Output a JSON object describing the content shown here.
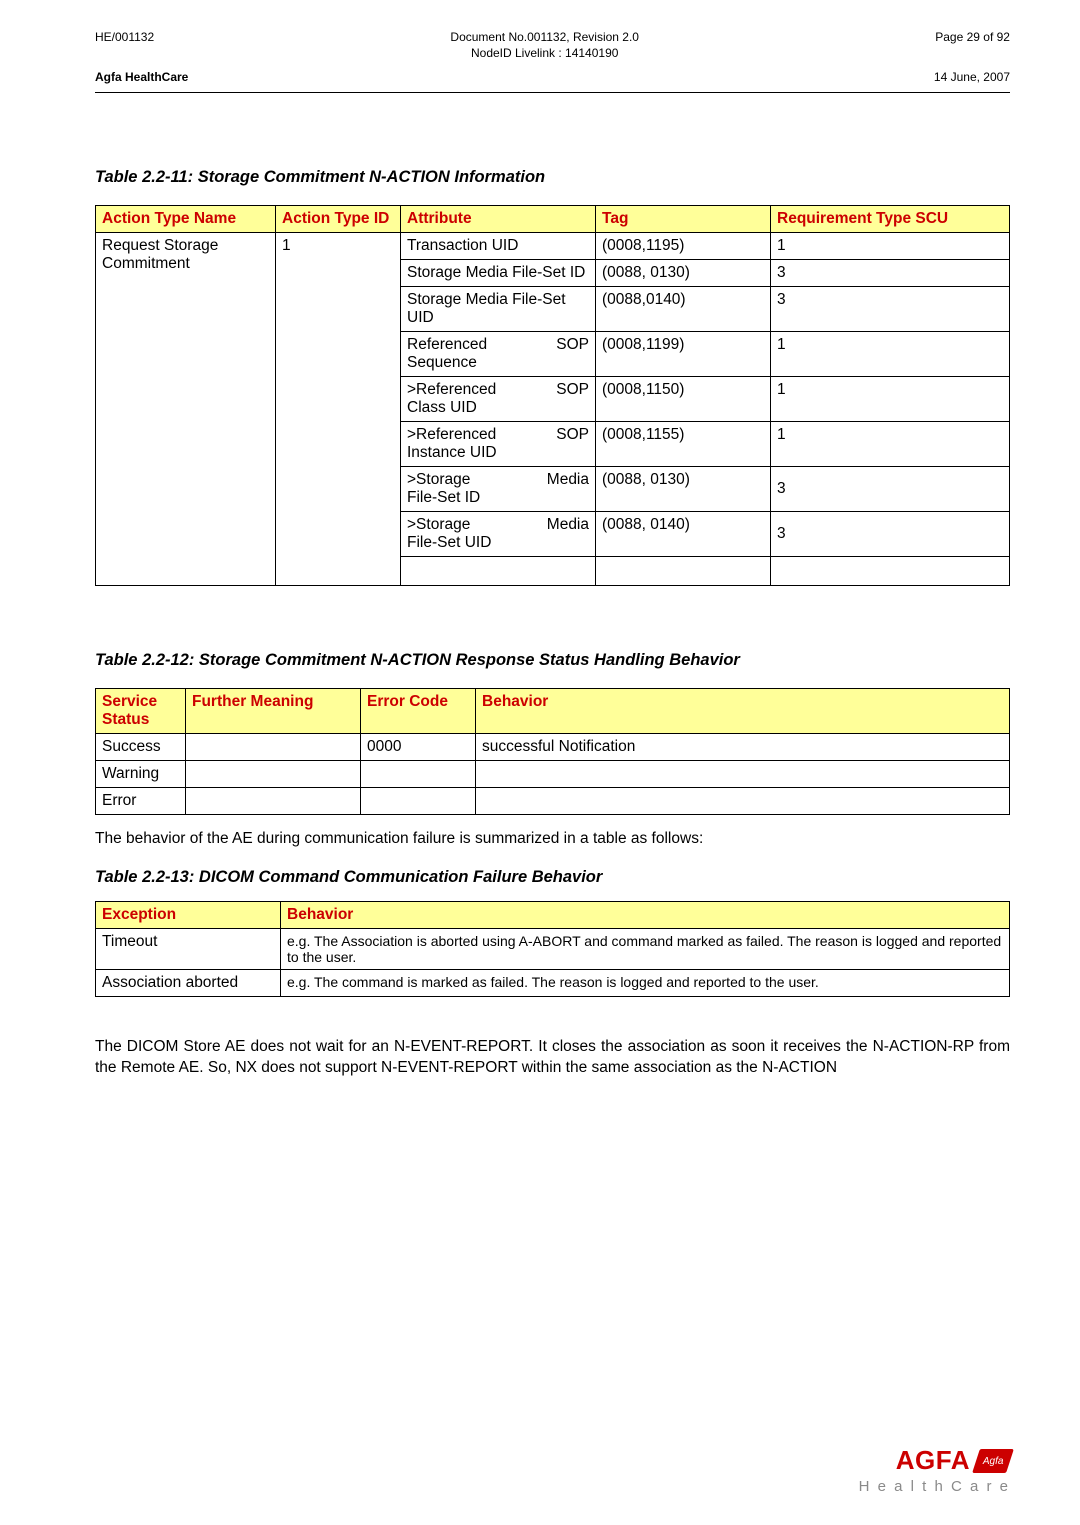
{
  "header": {
    "left_top": "HE/001132",
    "right_top": "Page 29 of 92",
    "center_line1": "Document No.001132, Revision 2.0",
    "center_line2": "NodeID Livelink : 14140190",
    "left_bottom": "Agfa HealthCare",
    "right_bottom": "14 June, 2007"
  },
  "t1": {
    "caption": "Table 2.2-11: Storage Commitment N-ACTION Information",
    "headers": {
      "h1": "Action Type Name",
      "h2": "Action Type ID",
      "h3": "Attribute",
      "h4": "Tag",
      "h5": "Requirement Type SCU"
    },
    "name": "Request Storage Commitment",
    "typeid": "1",
    "rows": [
      {
        "attr": "Transaction UID",
        "attr_r": "",
        "tag": "(0008,1195)",
        "req": "1"
      },
      {
        "attr": "Storage Media File-Set ID",
        "attr_r": "",
        "tag": "(0088, 0130)",
        "req": "3"
      },
      {
        "attr": "Storage Media File-Set UID",
        "attr_r": "",
        "tag": "(0088,0140)",
        "req": "3"
      },
      {
        "attr": "Referenced",
        "attr_r": "SOP",
        "attr2": "Sequence",
        "tag": "(0008,1199)",
        "req": "1"
      },
      {
        "attr": ">Referenced",
        "attr_r": "SOP",
        "attr2": "Class UID",
        "tag": "(0008,1150)",
        "req": "1"
      },
      {
        "attr": ">Referenced",
        "attr_r": "SOP",
        "attr2": "Instance UID",
        "tag": "(0008,1155)",
        "req": "1"
      },
      {
        "attr": ">Storage",
        "attr_r": "Media",
        "attr2": "File-Set ID",
        "tag": "(0088, 0130)",
        "req": "3"
      },
      {
        "attr": ">Storage",
        "attr_r": "Media",
        "attr2": "File-Set UID",
        "tag": "(0088, 0140)",
        "req": "3"
      }
    ]
  },
  "t2": {
    "caption": "Table 2.2-12: Storage Commitment N-ACTION Response Status Handling Behavior",
    "headers": {
      "h1": "Service Status",
      "h2": "Further Meaning",
      "h3": "Error Code",
      "h4": "Behavior"
    },
    "rows": [
      {
        "status": "Success",
        "fm": "",
        "code": "0000",
        "behavior": "successful Notification"
      },
      {
        "status": "Warning",
        "fm": "",
        "code": "",
        "behavior": ""
      },
      {
        "status": "Error",
        "fm": "",
        "code": "",
        "behavior": ""
      }
    ]
  },
  "para1": "The behavior of the AE during communication failure is summarized in a table as follows:",
  "t3": {
    "caption": "Table 2.2-13: DICOM Command Communication Failure Behavior",
    "headers": {
      "h1": "Exception",
      "h2": "Behavior"
    },
    "rows": [
      {
        "ex": "Timeout",
        "bh": "e.g. The Association is aborted using A-ABORT and command marked as failed.  The reason is logged and reported to the user."
      },
      {
        "ex": "Association aborted",
        "bh": "e.g. The command is marked as failed.  The reason is logged and reported to the user."
      }
    ]
  },
  "para2": "The DICOM Store AE does not wait for an N-EVENT-REPORT. It closes the association as soon it receives the N-ACTION-RP from the Remote AE. So, NX does not support N-EVENT-REPORT within the same association as the N-ACTION",
  "logo": {
    "brand": "AGFA",
    "inner": "Agfa",
    "sub": "H e a l t h C a r e"
  }
}
